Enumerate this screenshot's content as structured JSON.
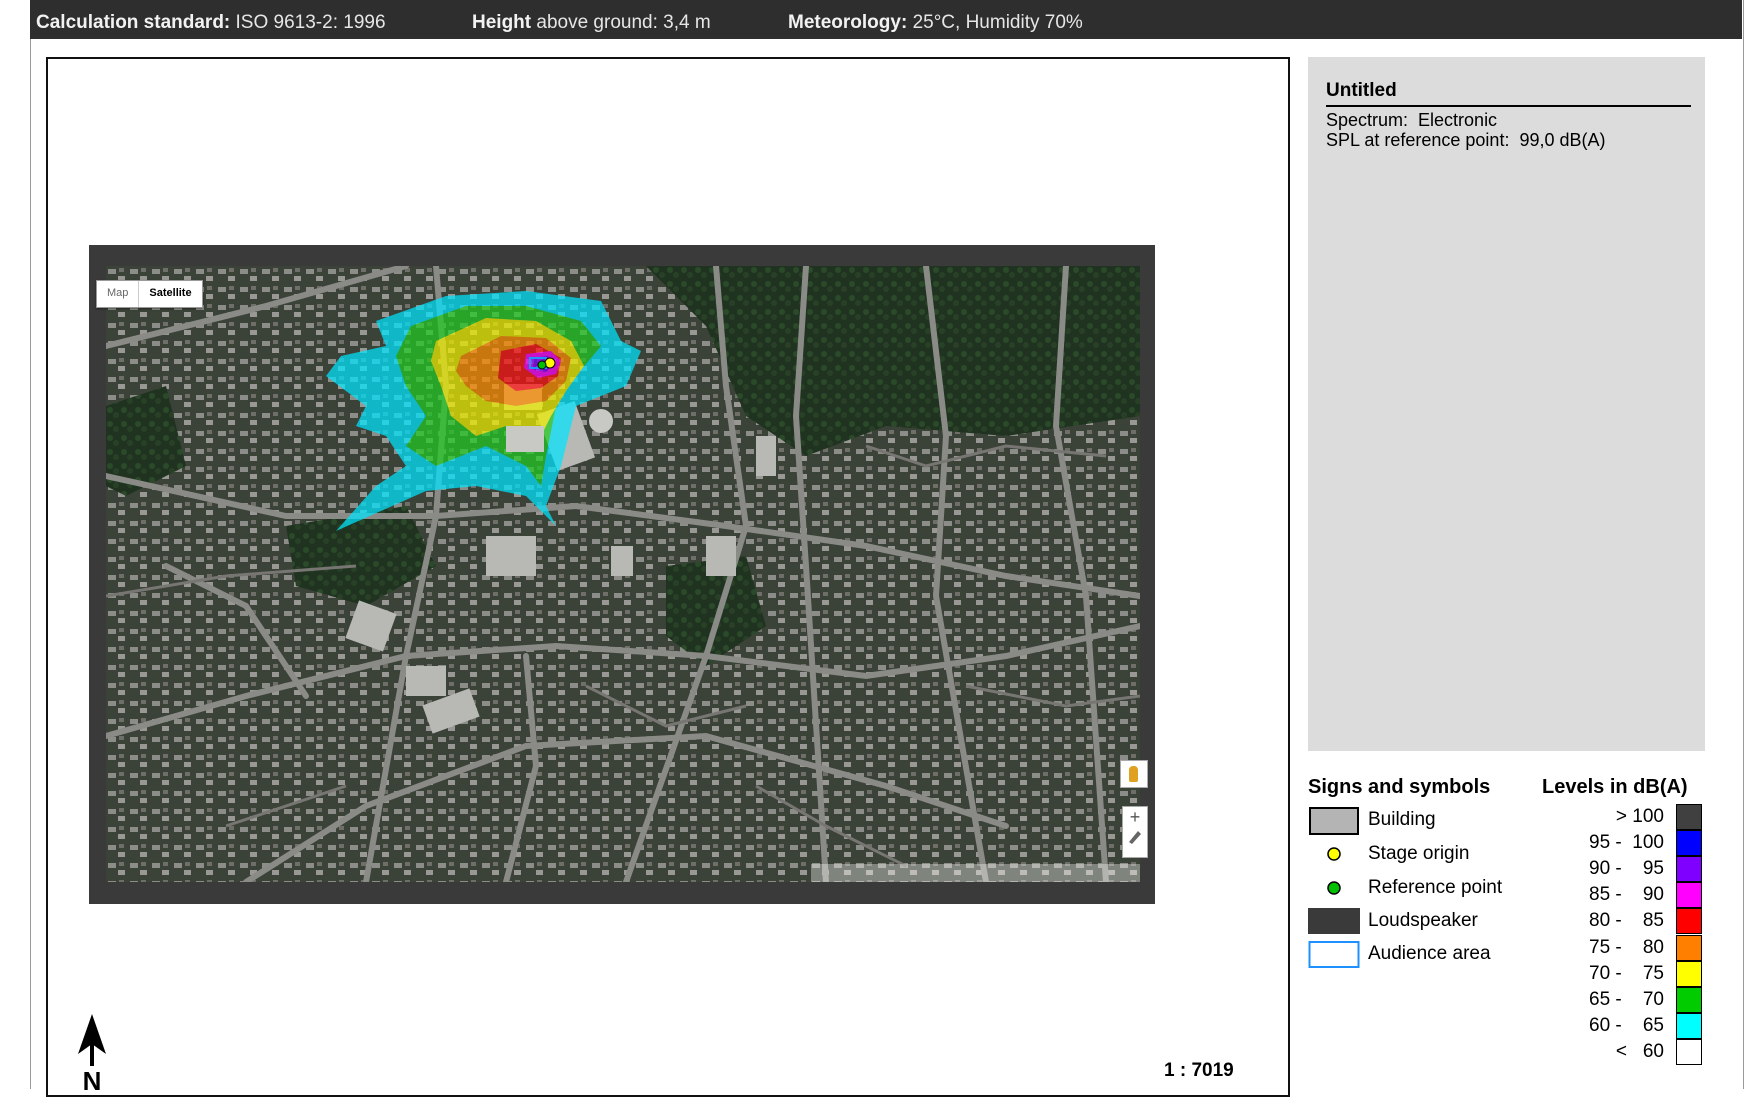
{
  "header": {
    "calc_label": "Calculation standard:",
    "calc_value": "ISO 9613-2: 1996",
    "height_label": "Height",
    "height_value": "above ground: 3,4 m",
    "meteo_label": "Meteorology:",
    "meteo_value": "25°C, Humidity 70%"
  },
  "map": {
    "toggle_map": "Map",
    "toggle_satellite": "Satellite",
    "active_view": "Satellite",
    "zoom_plus": "+",
    "scale": "1 : 7019",
    "north_label": "N"
  },
  "info": {
    "title": "Untitled",
    "spectrum": "Spectrum:  Electronic",
    "spl": "SPL at reference point:  99,0 dB(A)"
  },
  "symbols": {
    "heading": "Signs and symbols",
    "items": [
      {
        "label": "Building",
        "icon": "building-icon",
        "color": "#b4b4b4"
      },
      {
        "label": "Stage origin",
        "icon": "stage-origin-icon",
        "color": "#ffff00"
      },
      {
        "label": "Reference point",
        "icon": "reference-point-icon",
        "color": "#00c000"
      },
      {
        "label": "Loudspeaker",
        "icon": "loudspeaker-icon",
        "color": "#3a3a3a"
      },
      {
        "label": "Audience area",
        "icon": "audience-area-icon",
        "color": "#1e90ff"
      }
    ]
  },
  "levels": {
    "heading": "Levels in dB(A)",
    "items": [
      {
        "label": "> 100",
        "color": "#404040"
      },
      {
        "label": "95 -  100",
        "color": "#0000ff"
      },
      {
        "label": "90 -    95",
        "color": "#8000ff"
      },
      {
        "label": "85 -    90",
        "color": "#ff00ff"
      },
      {
        "label": "80 -    85",
        "color": "#ff0000"
      },
      {
        "label": "75 -    80",
        "color": "#ff8000"
      },
      {
        "label": "70 -    75",
        "color": "#ffff00"
      },
      {
        "label": "65 -    70",
        "color": "#00cc00"
      },
      {
        "label": "60 -    65",
        "color": "#00ffff"
      },
      {
        "label": "<   60",
        "color": "#ffffff"
      }
    ]
  }
}
